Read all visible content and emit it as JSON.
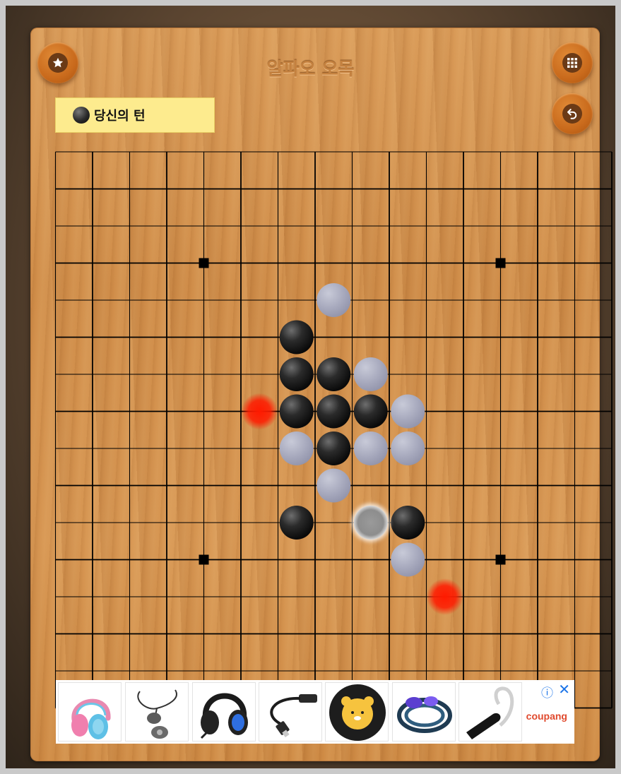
{
  "app": {
    "title": "알파오 오목"
  },
  "buttons": {
    "favorite": "star-icon",
    "menu": "grid-icon",
    "undo": "undo-icon"
  },
  "turn": {
    "label": "당신의 턴",
    "stone": "black"
  },
  "board": {
    "size": 15,
    "star_points": [
      [
        3,
        3
      ],
      [
        11,
        3
      ],
      [
        3,
        11
      ],
      [
        11,
        11
      ]
    ],
    "black": [
      [
        6,
        5
      ],
      [
        6,
        6
      ],
      [
        7,
        6
      ],
      [
        6,
        7
      ],
      [
        7,
        7
      ],
      [
        8,
        7
      ],
      [
        7,
        8
      ],
      [
        6,
        10
      ],
      [
        9,
        10
      ]
    ],
    "white": [
      [
        7,
        4
      ],
      [
        8,
        6
      ],
      [
        9,
        7
      ],
      [
        6,
        8
      ],
      [
        8,
        8
      ],
      [
        9,
        8
      ],
      [
        7,
        9
      ],
      [
        9,
        11
      ]
    ],
    "last_move": [
      8,
      10
    ],
    "hints": [
      [
        5,
        7
      ],
      [
        10,
        12
      ]
    ],
    "colors": {
      "line": "#000000",
      "hint": "#ff1a00",
      "black_stone": "#1a1a1a",
      "white_stone": "#a9abbf"
    }
  },
  "ad": {
    "brand": "coupang",
    "info_icon": "info-icon",
    "close_icon": "close-icon",
    "items": [
      "headphones-kids",
      "in-ear-monitor",
      "gaming-headset",
      "usb-c-adapter",
      "ryan-charger",
      "braided-earphones",
      "bluetooth-headset"
    ]
  }
}
